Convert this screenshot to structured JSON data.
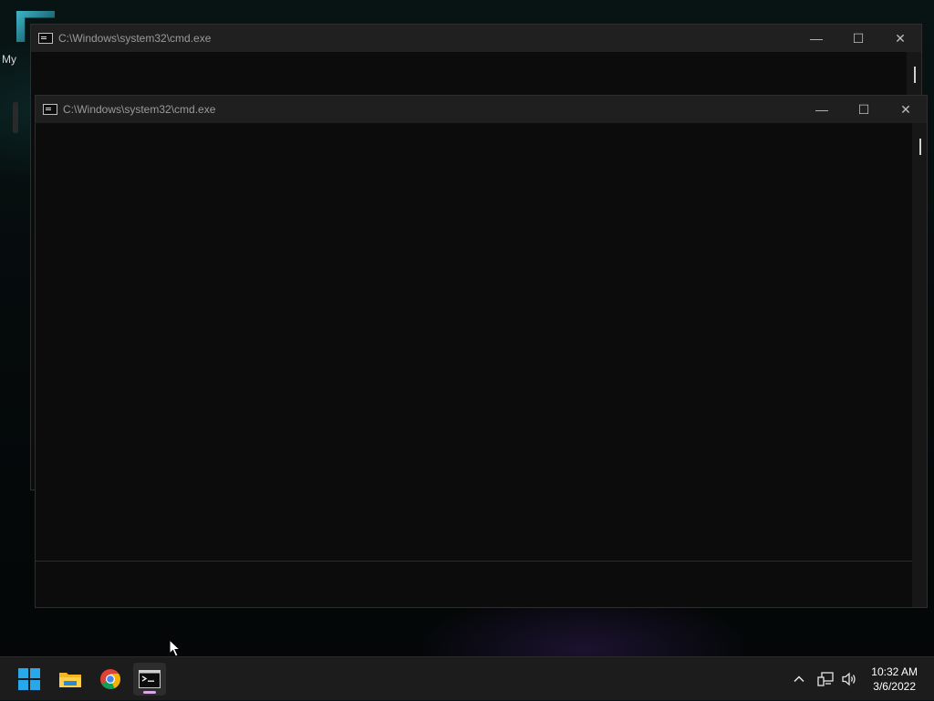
{
  "desktop": {
    "icon_label": "My"
  },
  "windows": [
    {
      "id": "cmd-back",
      "title": "C:\\Windows\\system32\\cmd.exe",
      "controls": {
        "minimize": "—",
        "maximize": "☐",
        "close": "✕"
      }
    },
    {
      "id": "cmd-front",
      "title": "C:\\Windows\\system32\\cmd.exe",
      "controls": {
        "minimize": "—",
        "maximize": "☐",
        "close": "✕"
      }
    }
  ],
  "taskbar": {
    "apps": [
      {
        "name": "Start",
        "icon": "windows-logo-icon"
      },
      {
        "name": "File Explorer",
        "icon": "folder-icon"
      },
      {
        "name": "Google Chrome",
        "icon": "chrome-icon"
      },
      {
        "name": "Command Prompt",
        "icon": "cmd-icon",
        "active": true
      }
    ],
    "tray": {
      "icons": [
        "chevron-up-icon",
        "network-icon",
        "volume-icon"
      ],
      "time": "10:32 AM",
      "date": "3/6/2022"
    }
  },
  "colors": {
    "console_bg": "#0c0c0c",
    "titlebar_bg": "#1f1f1f",
    "taskbar_bg": "#1c1c1c",
    "accent": "#0078d4"
  }
}
